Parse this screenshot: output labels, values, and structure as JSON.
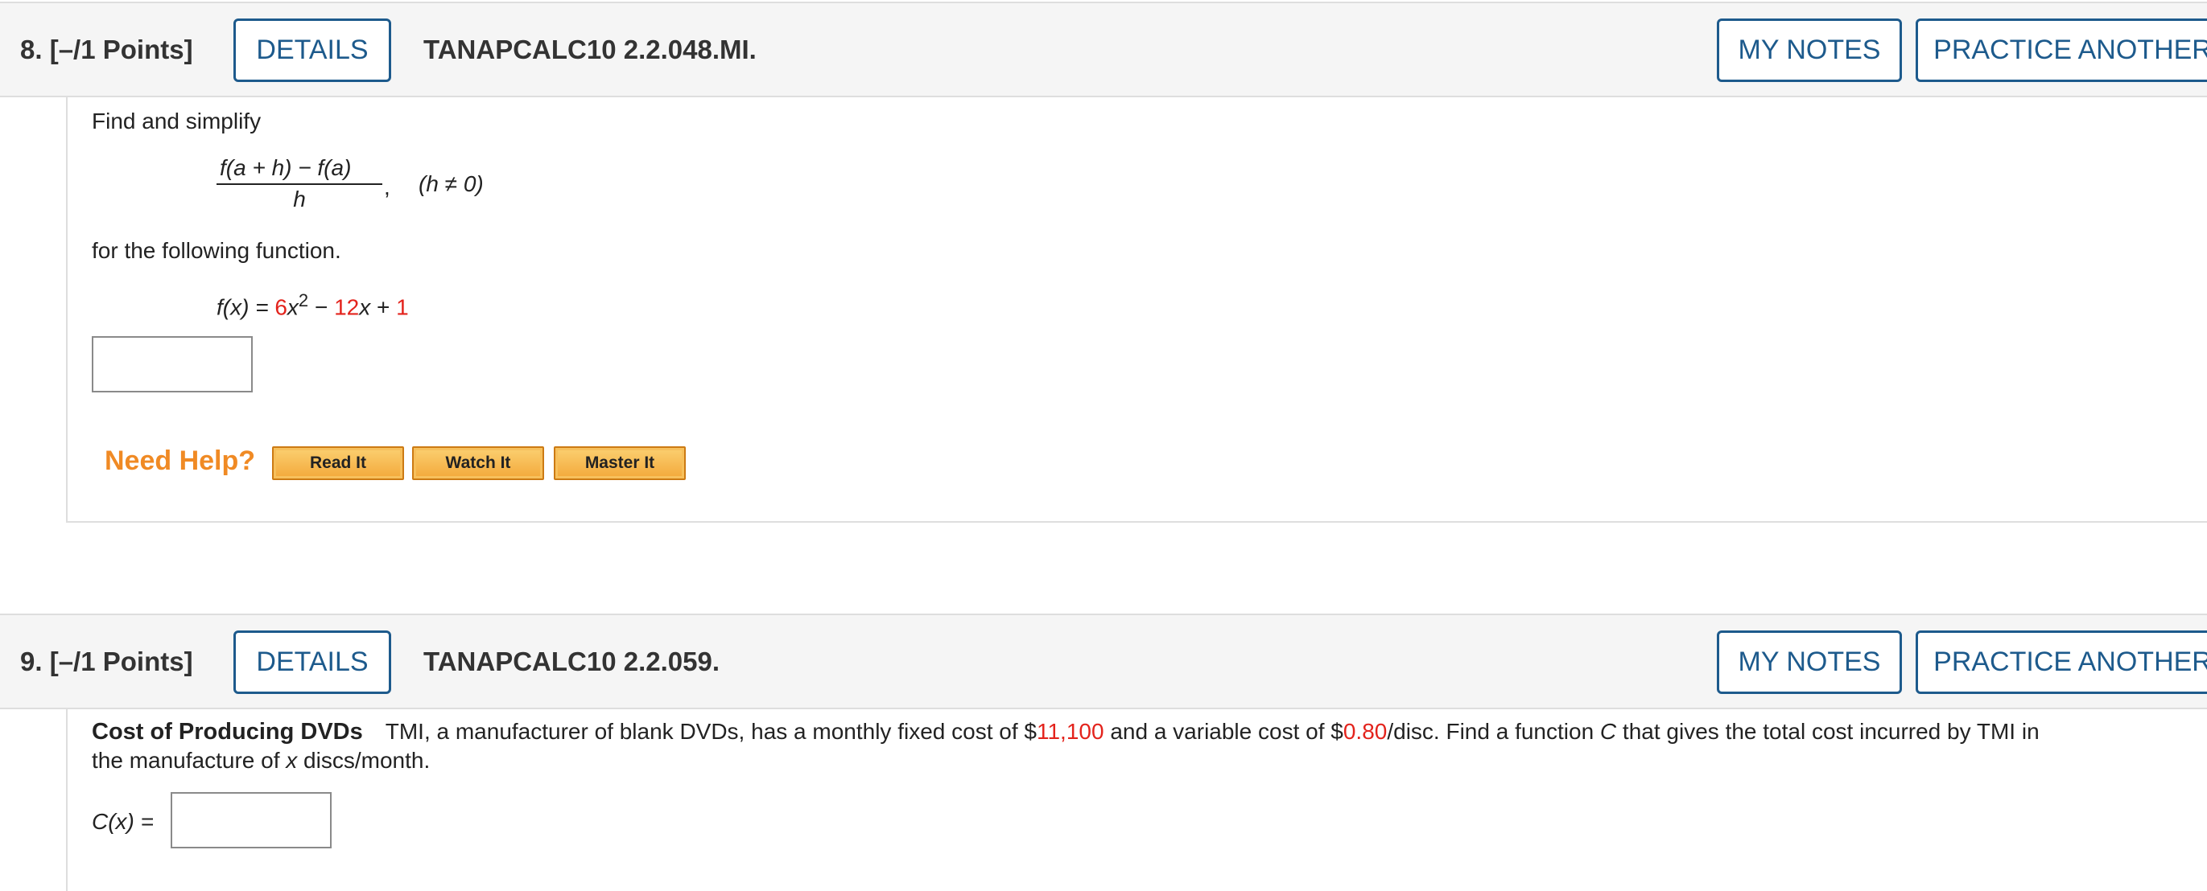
{
  "q8": {
    "number": "8.",
    "points": "[–/1 Points]",
    "details_label": "DETAILS",
    "code": "TANAPCALC10 2.2.048.MI.",
    "my_notes_label": "MY NOTES",
    "practice_label": "PRACTICE ANOTHER",
    "intro": "Find and simplify",
    "fraction_numerator": "f(a + h) − f(a)",
    "fraction_denominator": "h",
    "fraction_comma": ",",
    "condition": "(h ≠ 0)",
    "followup": "for the following function.",
    "function": {
      "lhs": "f(x) = ",
      "coef1": "6",
      "var1": "x",
      "exp1": "2",
      "minus": " − ",
      "coef2": "12",
      "var2": "x",
      "plus": " + ",
      "const": "1"
    },
    "answer_value": ""
  },
  "help": {
    "title": "Need Help?",
    "buttons": [
      "Read It",
      "Watch It",
      "Master It"
    ]
  },
  "q9": {
    "number": "9.",
    "points": "[–/1 Points]",
    "details_label": "DETAILS",
    "code": "TANAPCALC10 2.2.059.",
    "my_notes_label": "MY NOTES",
    "practice_label": "PRACTICE ANOTHER",
    "title": "Cost of Producing DVDs",
    "text1": "TMI, a manufacturer of blank DVDs, has a monthly fixed cost of $",
    "fixed_cost": "11,100",
    "text2": " and a variable cost of $",
    "variable_cost": "0.80",
    "text3": "/disc. Find a function ",
    "var_c": "C",
    "text4": " that gives the total cost incurred by TMI in",
    "line2a": "the manufacture of ",
    "var_x": "x",
    "line2b": " discs/month.",
    "answer_label": "C(x) =",
    "answer_value": ""
  },
  "colors": {
    "accent": "#1d5a8c",
    "highlight_red": "#e3231c",
    "help_orange": "#f08a24"
  }
}
